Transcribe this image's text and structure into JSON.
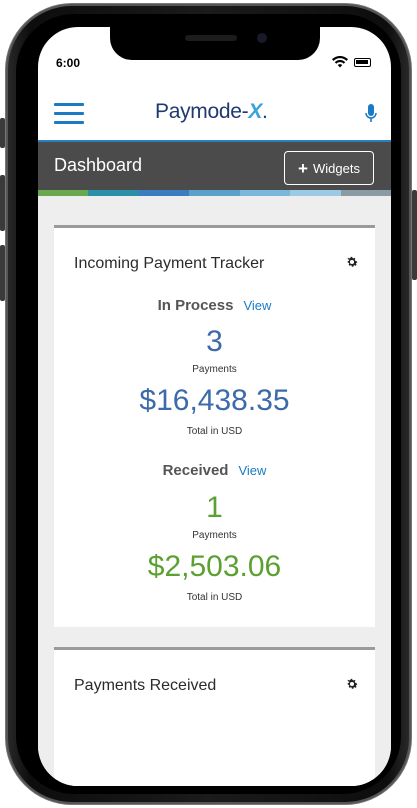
{
  "status_bar": {
    "time": "6:00"
  },
  "header": {
    "brand_main": "Paymode-",
    "brand_x": "X",
    "brand_dot": ".",
    "menu_icon": "hamburger-icon",
    "mic_icon": "microphone-icon"
  },
  "dashboard": {
    "title": "Dashboard",
    "widgets_button_label": "Widgets",
    "strip_colors": [
      "#6aa84f",
      "#2b8fa8",
      "#3b7dbf",
      "#5aa0c8",
      "#7ab8d9",
      "#9cc9e3",
      "#8a9ba6"
    ]
  },
  "tracker": {
    "title": "Incoming Payment Tracker",
    "in_process": {
      "label": "In Process",
      "view_label": "View",
      "count": "3",
      "count_label": "Payments",
      "amount": "$16,438.35",
      "amount_label": "Total in USD"
    },
    "received": {
      "label": "Received",
      "view_label": "View",
      "count": "1",
      "count_label": "Payments",
      "amount": "$2,503.06",
      "amount_label": "Total in USD"
    }
  },
  "payments_received": {
    "title": "Payments Received"
  },
  "colors": {
    "accent": "#1a7bc4",
    "in_process": "#3d6aa8",
    "received": "#5aa132",
    "bar": "#4b4b4b"
  }
}
